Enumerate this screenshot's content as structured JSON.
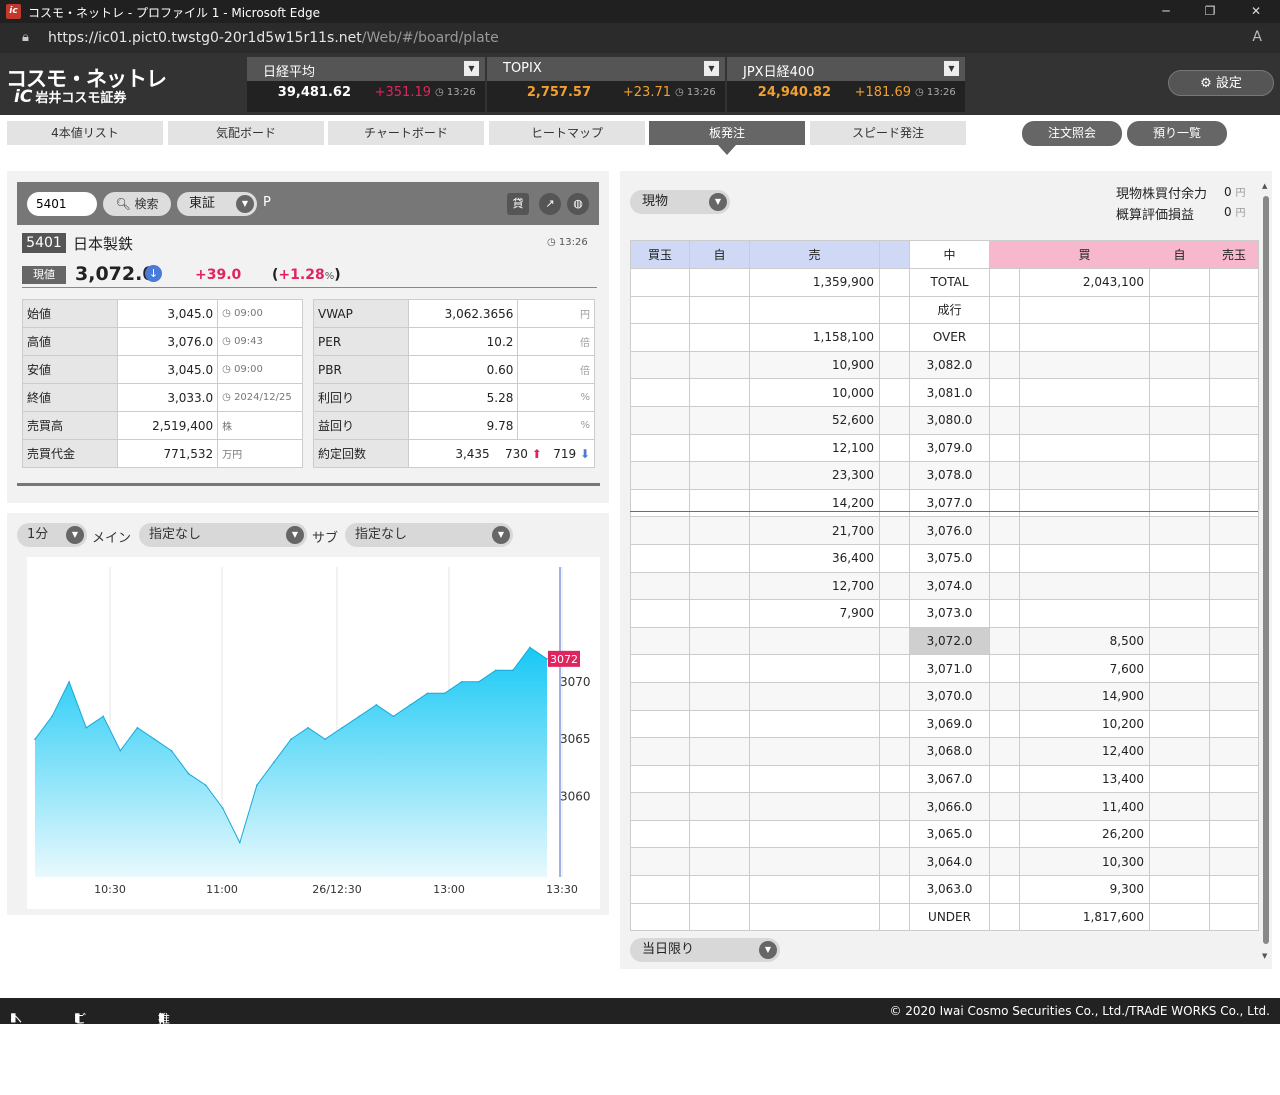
{
  "window": {
    "title": "コスモ・ネットレ - プロファイル 1 - Microsoft Edge",
    "url_host": "https://ic01.pict0.twstg0-20r1d5w15r11s.net",
    "url_path": "/Web/#/board/plate"
  },
  "logo": {
    "main": "コスモ・ネットレ",
    "sub": "岩井コスモ証券"
  },
  "indices": [
    {
      "name": "日経平均",
      "value": "39,481.62",
      "change": "+351.19",
      "time": "13:26",
      "change_color": "#e0245e"
    },
    {
      "name": "TOPIX",
      "value": "2,757.57",
      "change": "+23.71",
      "time": "13:26",
      "change_color": "#f0a030"
    },
    {
      "name": "JPX日経400",
      "value": "24,940.82",
      "change": "+181.69",
      "time": "13:26",
      "change_color": "#f0a030"
    }
  ],
  "settings_label": "設定",
  "tabs": [
    "4本値リスト",
    "気配ボード",
    "チャートボード",
    "ヒートマップ",
    "板発注",
    "スピード発注"
  ],
  "active_tab": "板発注",
  "pills": [
    "注文照会",
    "預り一覧"
  ],
  "search": {
    "code": "5401",
    "button": "検索",
    "market": "東証",
    "p": "P",
    "lend": "貸"
  },
  "stock": {
    "code": "5401",
    "name": "日本製鉄",
    "time": "13:26",
    "price_badge": "現値",
    "price": "3,072.0",
    "change": "+39.0",
    "pct_open": "(",
    "pct": "+1.28",
    "pct_unit": "%",
    "pct_close": ")"
  },
  "quote_left": [
    {
      "label": "始値",
      "value": "3,045.0",
      "sub": "09:00"
    },
    {
      "label": "高値",
      "value": "3,076.0",
      "sub": "09:43"
    },
    {
      "label": "安値",
      "value": "3,045.0",
      "sub": "09:00"
    },
    {
      "label": "終値",
      "value": "3,033.0",
      "sub": "2024/12/25"
    },
    {
      "label": "売買高",
      "value": "2,519,400",
      "sub": "株"
    },
    {
      "label": "売買代金",
      "value": "771,532",
      "sub": "万円"
    }
  ],
  "quote_right": [
    {
      "label": "VWAP",
      "value": "3,062.3656",
      "unit": "円"
    },
    {
      "label": "PER",
      "value": "10.2",
      "unit": "倍"
    },
    {
      "label": "PBR",
      "value": "0.60",
      "unit": "倍"
    },
    {
      "label": "利回り",
      "value": "5.28",
      "unit": "%"
    },
    {
      "label": "益回り",
      "value": "9.78",
      "unit": "%"
    },
    {
      "label": "約定回数",
      "value": "3,435",
      "up": "730",
      "down": "719"
    }
  ],
  "chart_controls": {
    "interval": "1分",
    "main_label": "メイン",
    "main_value": "指定なし",
    "sub_label": "サブ",
    "sub_value": "指定なし"
  },
  "chart_data": {
    "type": "area",
    "x_ticks": [
      "10:30",
      "11:00",
      "26/12:30",
      "13:00",
      "13:30"
    ],
    "y_ticks": [
      3070,
      3065,
      3060
    ],
    "ylim": [
      3053,
      3080
    ],
    "last_label": "3072",
    "x": [
      "10:00",
      "10:05",
      "10:10",
      "10:15",
      "10:20",
      "10:25",
      "10:30",
      "10:35",
      "10:40",
      "10:45",
      "10:50",
      "10:55",
      "11:00",
      "11:05",
      "11:10",
      "11:15",
      "11:20",
      "11:25",
      "11:30",
      "12:30",
      "12:35",
      "12:40",
      "12:45",
      "12:50",
      "12:55",
      "13:00",
      "13:05",
      "13:10",
      "13:15",
      "13:20",
      "13:25"
    ],
    "values": [
      3065,
      3067,
      3070,
      3066,
      3067,
      3064,
      3066,
      3065,
      3064,
      3062,
      3061,
      3059,
      3056,
      3061,
      3063,
      3065,
      3066,
      3065,
      3066,
      3067,
      3068,
      3067,
      3068,
      3069,
      3069,
      3070,
      3070,
      3071,
      3071,
      3073,
      3072
    ]
  },
  "board_controls": {
    "type": "現物",
    "order": "当日限り"
  },
  "balance": [
    {
      "label": "現物株買付余力",
      "value": "0",
      "unit": "円"
    },
    {
      "label": "概算評価損益",
      "value": "0",
      "unit": "円"
    }
  ],
  "board_headers": [
    "買玉",
    "自",
    "売",
    "",
    "中",
    "",
    "買",
    "自",
    "売玉"
  ],
  "board_top": [
    {
      "sell": "1,359,900",
      "mid": "TOTAL",
      "buy": "2,043,100"
    },
    {
      "sell": "",
      "mid": "成行",
      "buy": ""
    },
    {
      "sell": "1,158,100",
      "mid": "OVER",
      "buy": ""
    }
  ],
  "board_rows": [
    {
      "sell": "10,900",
      "mid": "3,082.0",
      "buy": ""
    },
    {
      "sell": "10,000",
      "mid": "3,081.0",
      "buy": ""
    },
    {
      "sell": "52,600",
      "mid": "3,080.0",
      "buy": ""
    },
    {
      "sell": "12,100",
      "mid": "3,079.0",
      "buy": ""
    },
    {
      "sell": "23,300",
      "mid": "3,078.0",
      "buy": ""
    },
    {
      "sell": "14,200",
      "mid": "3,077.0",
      "buy": ""
    },
    {
      "sell": "21,700",
      "mid": "3,076.0",
      "buy": ""
    },
    {
      "sell": "36,400",
      "mid": "3,075.0",
      "buy": ""
    },
    {
      "sell": "12,700",
      "mid": "3,074.0",
      "buy": ""
    },
    {
      "sell": "7,900",
      "mid": "3,073.0",
      "buy": ""
    },
    {
      "sell": "",
      "mid": "3,072.0",
      "buy": "8,500"
    },
    {
      "sell": "",
      "mid": "3,071.0",
      "buy": "7,600"
    },
    {
      "sell": "",
      "mid": "3,070.0",
      "buy": "14,900"
    },
    {
      "sell": "",
      "mid": "3,069.0",
      "buy": "10,200"
    },
    {
      "sell": "",
      "mid": "3,068.0",
      "buy": "12,400"
    },
    {
      "sell": "",
      "mid": "3,067.0",
      "buy": "13,400"
    },
    {
      "sell": "",
      "mid": "3,066.0",
      "buy": "11,400"
    },
    {
      "sell": "",
      "mid": "3,065.0",
      "buy": "26,200"
    },
    {
      "sell": "",
      "mid": "3,064.0",
      "buy": "10,300"
    },
    {
      "sell": "",
      "mid": "3,063.0",
      "buy": "9,300"
    }
  ],
  "board_under": {
    "mid": "UNDER",
    "buy": "1,817,600"
  },
  "footer": {
    "help": "ヘルプ",
    "terms": "ご利用規約",
    "env": "推奨環境",
    "copyright": "© 2020 Iwai Cosmo Securities Co., Ltd./TRAdE WORKS Co., Ltd."
  }
}
